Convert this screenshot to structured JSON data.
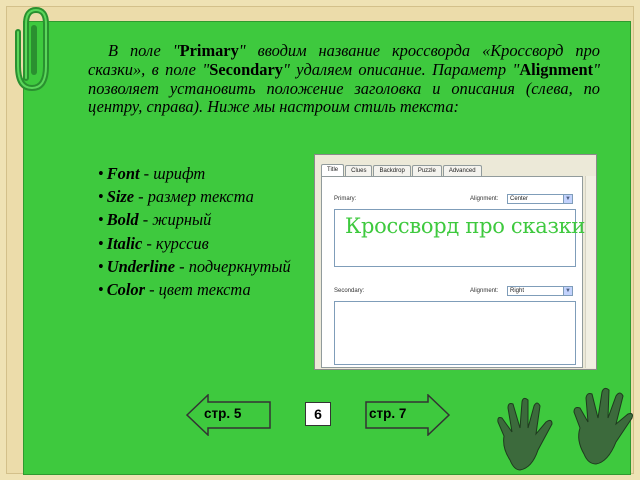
{
  "description": {
    "p1": "В поле \"",
    "primary": "Primary",
    "p2": "\" вводим название кроссворда «Кроссворд про сказки», в поле \"",
    "secondary": "Secondary",
    "p3": "\" удаляем описание. Параметр \"",
    "alignment": "Alignment",
    "p4": "\" позволяет установить положение заголовка и описания (слева, по центру, справа). Ниже мы настроим стиль текста:"
  },
  "properties": [
    {
      "name": "Font",
      "desc": " - шрифт"
    },
    {
      "name": "Size",
      "desc": " - размер текста"
    },
    {
      "name": "Bold",
      "desc": " - жирный"
    },
    {
      "name": "Italic",
      "desc": " - курссив"
    },
    {
      "name": "Underline",
      "desc": " - подчеркнутый"
    },
    {
      "name": "Color",
      "desc": " - цвет текста"
    }
  ],
  "screenshot": {
    "tabs": [
      "Title",
      "Clues",
      "Backdrop",
      "Puzzle",
      "Advanced"
    ],
    "primary_label": "Primary:",
    "alignment_label": "Alignment:",
    "primary_alignment": "Center",
    "primary_text": "Кроссворд про сказки",
    "secondary_label": "Secondary:",
    "secondary_alignment": "Right",
    "primary_text_color": "#3ec93e"
  },
  "navigation": {
    "prev_label": "стр. 5",
    "page": "6",
    "next_label": "стр. 7"
  },
  "colors": {
    "slide_bg": "#3ec93e",
    "frame_bg": "#ecdcaa",
    "hands": "#3c6a3c"
  },
  "icons": [
    "paperclip-icon",
    "hands-icon",
    "arrow-left-icon",
    "arrow-right-icon",
    "dropdown-arrow-icon"
  ]
}
